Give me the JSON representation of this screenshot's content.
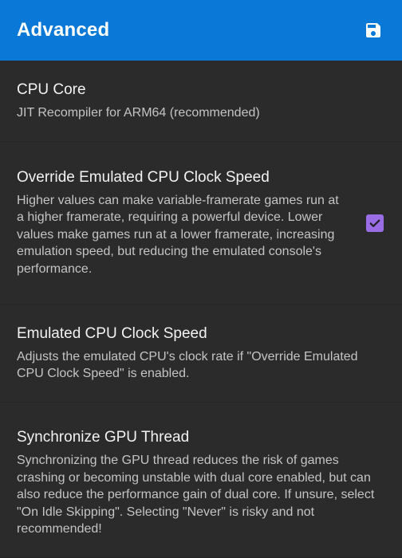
{
  "header": {
    "title": "Advanced",
    "save_icon": "save-icon"
  },
  "colors": {
    "header_bg": "#0a78d7",
    "background": "#2b2b2b",
    "checkbox_accent": "#9a6de6"
  },
  "settings": [
    {
      "title": "CPU Core",
      "description": "JIT Recompiler for ARM64 (recommended)"
    },
    {
      "title": "Override Emulated CPU Clock Speed",
      "description": "Higher values can make variable-framerate games run at a higher framerate, requiring a powerful device. Lower values make games run at a lower framerate, increasing emulation speed, but reducing the emulated console's performance.",
      "checked": true
    },
    {
      "title": "Emulated CPU Clock Speed",
      "description": "Adjusts the emulated CPU's clock rate if \"Override Emulated CPU Clock Speed\" is enabled."
    },
    {
      "title": "Synchronize GPU Thread",
      "description": "Synchronizing the GPU thread reduces the risk of games crashing or becoming unstable with dual core enabled, but can also reduce the performance gain of dual core. If unsure, select \"On Idle Skipping\". Selecting \"Never\" is risky and not recommended!"
    }
  ]
}
